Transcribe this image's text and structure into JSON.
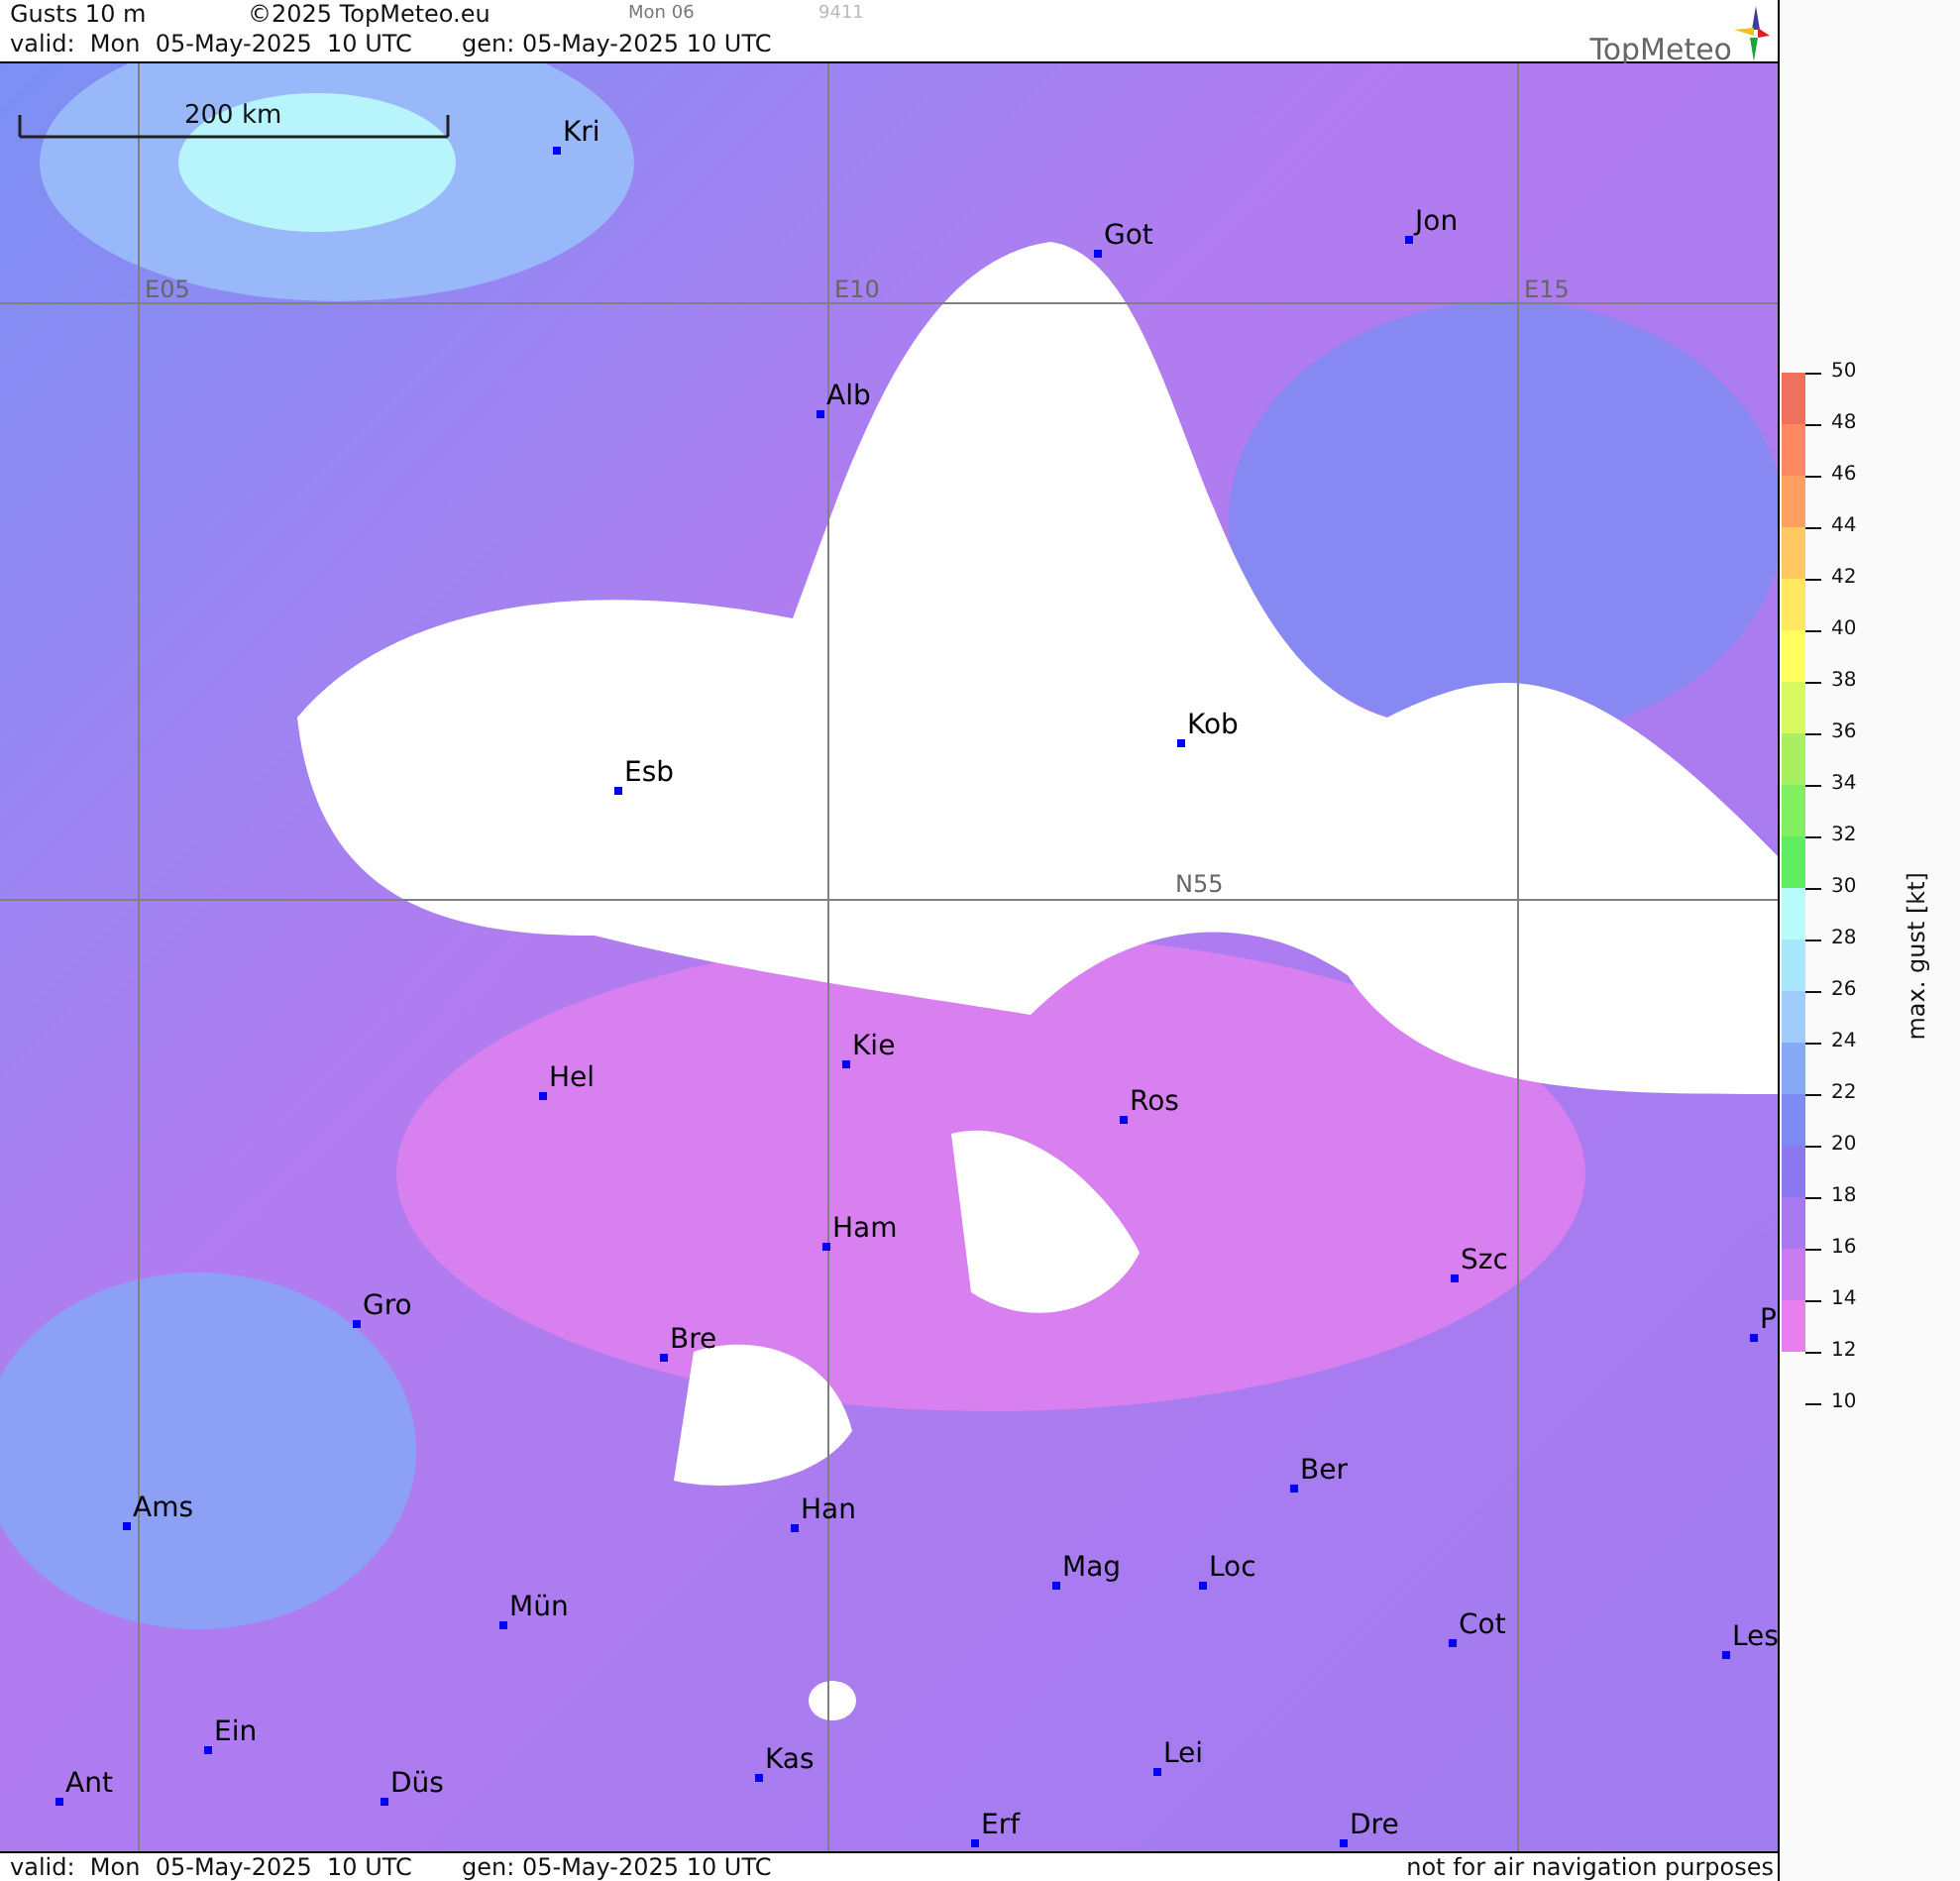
{
  "header": {
    "product": "Gusts 10 m",
    "copyright": "©2025 TopMeteo.eu",
    "day_tag": "Mon 06",
    "code": "9411",
    "valid": "valid:  Mon  05-May-2025  10 UTC",
    "gen": "gen: 05-May-2025 10 UTC",
    "logo": "TopMeteo"
  },
  "map": {
    "scale": "200 km",
    "grid_labels": [
      "E05",
      "E10",
      "E15",
      "N55"
    ],
    "cities": [
      {
        "name": "Kri"
      },
      {
        "name": "Got"
      },
      {
        "name": "Jon"
      },
      {
        "name": "Alb"
      },
      {
        "name": "Kob"
      },
      {
        "name": "Esb"
      },
      {
        "name": "Kie"
      },
      {
        "name": "Hel"
      },
      {
        "name": "Ros"
      },
      {
        "name": "Ham"
      },
      {
        "name": "Szc"
      },
      {
        "name": "Gro"
      },
      {
        "name": "Bre"
      },
      {
        "name": "P"
      },
      {
        "name": "Ber"
      },
      {
        "name": "Ams"
      },
      {
        "name": "Han"
      },
      {
        "name": "Mag"
      },
      {
        "name": "Loc"
      },
      {
        "name": "Mün"
      },
      {
        "name": "Cot"
      },
      {
        "name": "Les"
      },
      {
        "name": "Ein"
      },
      {
        "name": "Kas"
      },
      {
        "name": "Lei"
      },
      {
        "name": "Ant"
      },
      {
        "name": "Düs"
      },
      {
        "name": "Dre"
      },
      {
        "name": "Erf"
      }
    ]
  },
  "footer": {
    "valid": "valid:  Mon  05-May-2025  10 UTC",
    "gen": "gen: 05-May-2025 10 UTC",
    "note": "not for air navigation purposes"
  },
  "legend": {
    "title": "max. gust [kt]",
    "ticks": [
      "50",
      "48",
      "46",
      "44",
      "42",
      "40",
      "38",
      "36",
      "34",
      "32",
      "30",
      "28",
      "26",
      "24",
      "22",
      "20",
      "18",
      "16",
      "14",
      "12",
      "10"
    ],
    "bands": [
      {
        "color": "#f07060"
      },
      {
        "color": "#ff8860"
      },
      {
        "color": "#ffa060"
      },
      {
        "color": "#ffc860"
      },
      {
        "color": "#ffe860"
      },
      {
        "color": "#ffff60"
      },
      {
        "color": "#d8f860"
      },
      {
        "color": "#a8f060"
      },
      {
        "color": "#80f060"
      },
      {
        "color": "#60ec60"
      },
      {
        "color": "#b8fcfc"
      },
      {
        "color": "#a8e8fc"
      },
      {
        "color": "#a0ccfc"
      },
      {
        "color": "#88a8f8"
      },
      {
        "color": "#7c8cf4"
      },
      {
        "color": "#8c78f0"
      },
      {
        "color": "#a878f0"
      },
      {
        "color": "#c87cf0"
      },
      {
        "color": "#e87ef0"
      }
    ]
  }
}
